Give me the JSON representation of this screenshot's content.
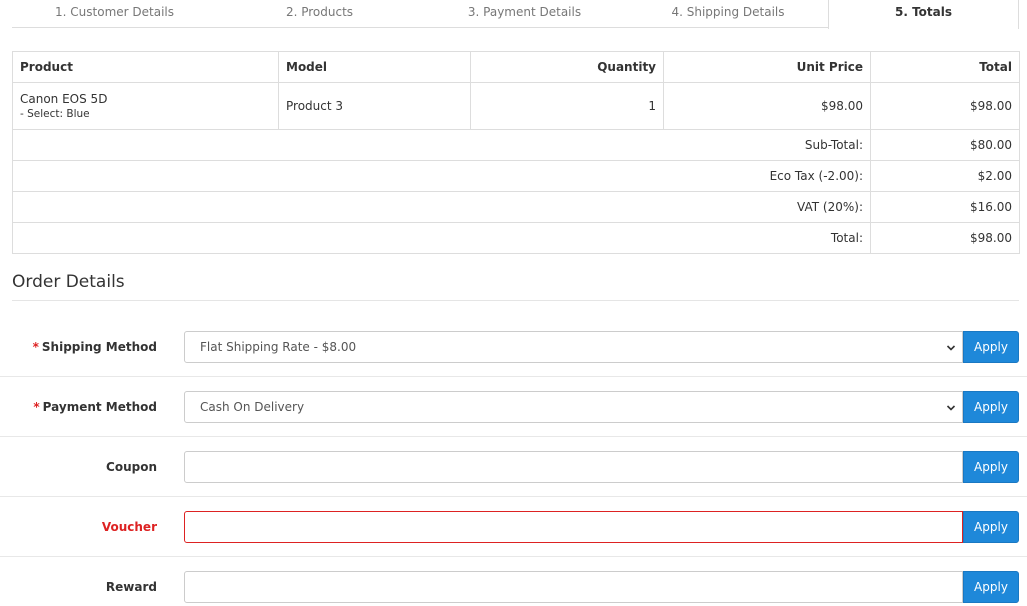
{
  "tabs": [
    {
      "label": "1. Customer Details"
    },
    {
      "label": "2. Products"
    },
    {
      "label": "3. Payment Details"
    },
    {
      "label": "4. Shipping Details"
    },
    {
      "label": "5. Totals"
    }
  ],
  "products_table": {
    "headers": {
      "product": "Product",
      "model": "Model",
      "quantity": "Quantity",
      "unit_price": "Unit Price",
      "total": "Total"
    },
    "rows": [
      {
        "product": "Canon EOS 5D",
        "option": "- Select: Blue",
        "model": "Product 3",
        "quantity": "1",
        "unit_price": "$98.00",
        "total": "$98.00"
      }
    ],
    "totals": [
      {
        "label": "Sub-Total:",
        "value": "$80.00"
      },
      {
        "label": "Eco Tax (-2.00):",
        "value": "$2.00"
      },
      {
        "label": "VAT (20%):",
        "value": "$16.00"
      },
      {
        "label": "Total:",
        "value": "$98.00"
      }
    ]
  },
  "order_details": {
    "title": "Order Details",
    "apply_label": "Apply",
    "shipping_method": {
      "label": "Shipping Method",
      "value": "Flat Shipping Rate - $8.00"
    },
    "payment_method": {
      "label": "Payment Method",
      "value": "Cash On Delivery"
    },
    "coupon": {
      "label": "Coupon",
      "value": ""
    },
    "voucher": {
      "label": "Voucher",
      "value": ""
    },
    "reward": {
      "label": "Reward",
      "value": ""
    }
  },
  "colors": {
    "accent": "#1e88d9",
    "error": "#dd2222",
    "border": "#dddddd"
  }
}
